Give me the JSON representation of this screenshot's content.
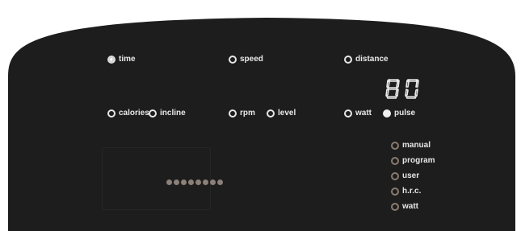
{
  "indicators": {
    "time": "time",
    "speed": "speed",
    "distance": "distance",
    "calories": "calories",
    "incline": "incline",
    "rpm": "rpm",
    "level": "level",
    "watt": "watt",
    "pulse": "pulse"
  },
  "display": {
    "value": "80"
  },
  "programs": {
    "manual": "manual",
    "program": "program",
    "user": "user",
    "hrc": "h.r.c.",
    "watt": "watt"
  },
  "matrix": {
    "dot_count": 8
  },
  "colors": {
    "panel": "#1d1d1d",
    "indicator_ring": "#e6e6e6",
    "program_ring": "#8a7a6e",
    "matrix_dot": "#8c8079"
  },
  "icons": {
    "indicator": "led-ring-icon",
    "display": "seven-segment-digits-icon"
  }
}
